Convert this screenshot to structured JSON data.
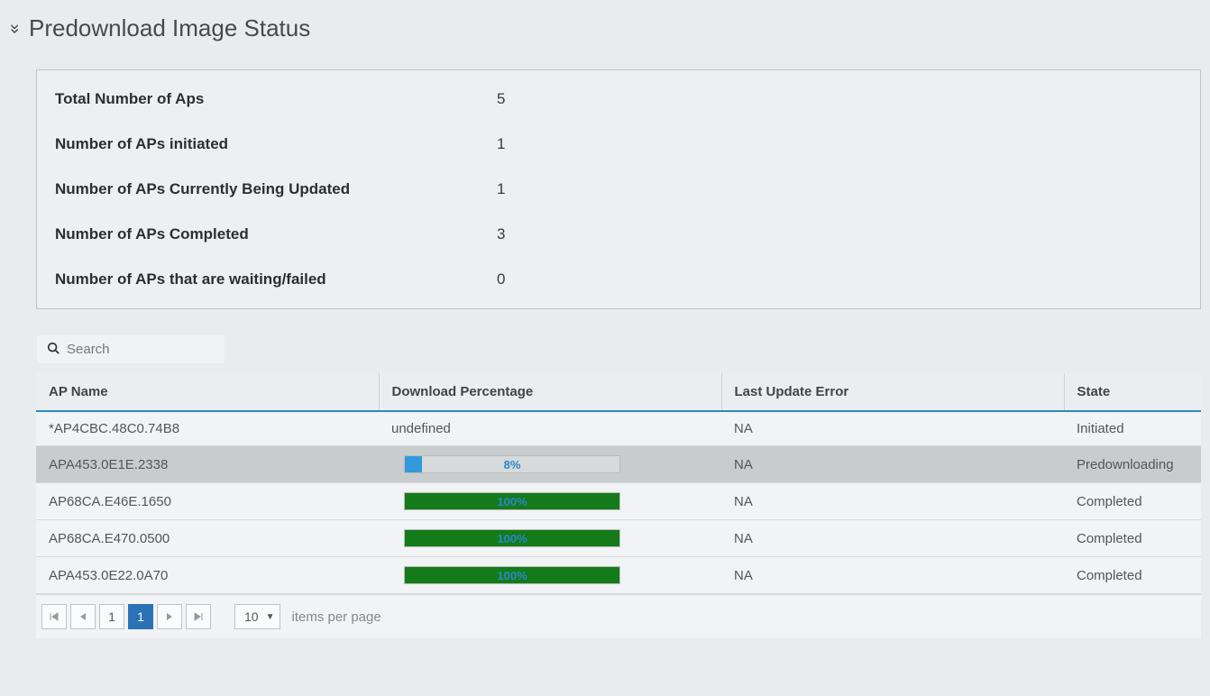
{
  "page": {
    "title": "Predownload Image Status"
  },
  "summary": {
    "rows": [
      {
        "label": "Total Number of Aps",
        "value": "5"
      },
      {
        "label": "Number of APs initiated",
        "value": "1"
      },
      {
        "label": "Number of APs Currently Being Updated",
        "value": "1"
      },
      {
        "label": "Number of APs Completed",
        "value": "3"
      },
      {
        "label": "Number of APs that are waiting/failed",
        "value": "0"
      }
    ]
  },
  "search": {
    "placeholder": "Search",
    "value": ""
  },
  "table": {
    "columns": {
      "ap_name": "AP Name",
      "download_pct": "Download Percentage",
      "last_error": "Last Update Error",
      "state": "State"
    },
    "rows": [
      {
        "ap_name": "*AP4CBC.48C0.74B8",
        "download_text": "undefined",
        "download_pct": null,
        "last_error": "NA",
        "state": "Initiated",
        "progress_color": "none"
      },
      {
        "ap_name": "APA453.0E1E.2338",
        "download_text": "8%",
        "download_pct": 8,
        "last_error": "NA",
        "state": "Predownloading",
        "progress_color": "blue",
        "alt": true
      },
      {
        "ap_name": "AP68CA.E46E.1650",
        "download_text": "100%",
        "download_pct": 100,
        "last_error": "NA",
        "state": "Completed",
        "progress_color": "green"
      },
      {
        "ap_name": "AP68CA.E470.0500",
        "download_text": "100%",
        "download_pct": 100,
        "last_error": "NA",
        "state": "Completed",
        "progress_color": "green"
      },
      {
        "ap_name": "APA453.0E22.0A70",
        "download_text": "100%",
        "download_pct": 100,
        "last_error": "NA",
        "state": "Completed",
        "progress_color": "green"
      }
    ]
  },
  "pager": {
    "first_icon": "⏮",
    "prev_icon": "◀",
    "pages": [
      "1"
    ],
    "current_page": "1",
    "next_icon": "▶",
    "last_icon": "⏭",
    "page_size": "10",
    "items_label": "items per page"
  }
}
